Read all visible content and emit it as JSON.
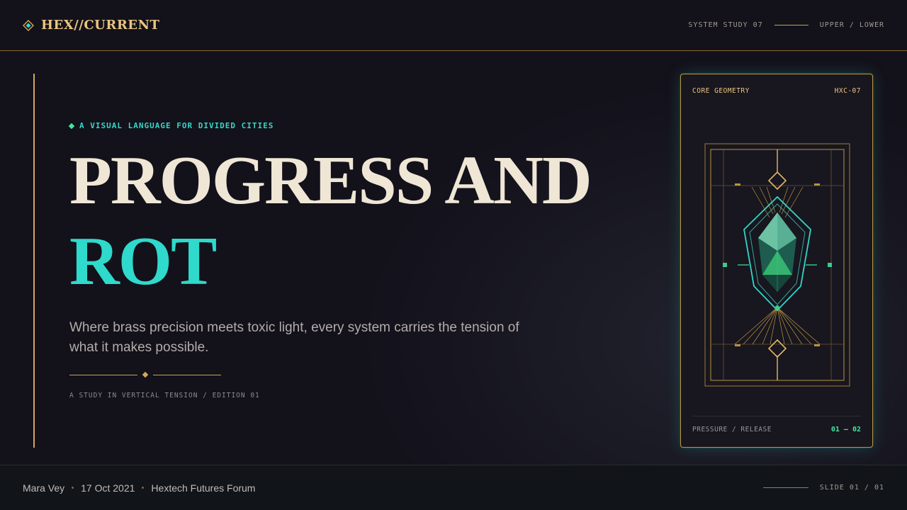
{
  "header": {
    "brand": "HEX//CURRENT",
    "study": "SYSTEM STUDY 07",
    "mode": "UPPER / LOWER"
  },
  "hero": {
    "eyebrow": "A VISUAL LANGUAGE FOR DIVIDED CITIES",
    "title_line_1": "PROGRESS AND",
    "title_line_2": "ROT",
    "subtitle": "Where brass precision meets toxic light, every system carries the tension of what it makes possible.",
    "caption": "A STUDY IN VERTICAL TENSION / EDITION 01"
  },
  "card": {
    "label": "CORE GEOMETRY",
    "code": "HXC-07",
    "bottom_label": "PRESSURE / RELEASE",
    "bottom_value": "01 — 02"
  },
  "footer": {
    "author": "Mara Vey",
    "date": "17 Oct 2021",
    "event": "Hextech Futures Forum",
    "slide": "SLIDE 01 / 01"
  },
  "colors": {
    "background": "#13111a",
    "brass": "#d4a85a",
    "teal": "#2fd9cb",
    "toxic_green": "#3ee8a0",
    "cream": "#efe6d6"
  },
  "icons": {
    "brand": "diamond-gem-icon",
    "eyebrow": "diamond-bullet-icon",
    "card_art": "crystal-core-geometry-icon"
  }
}
